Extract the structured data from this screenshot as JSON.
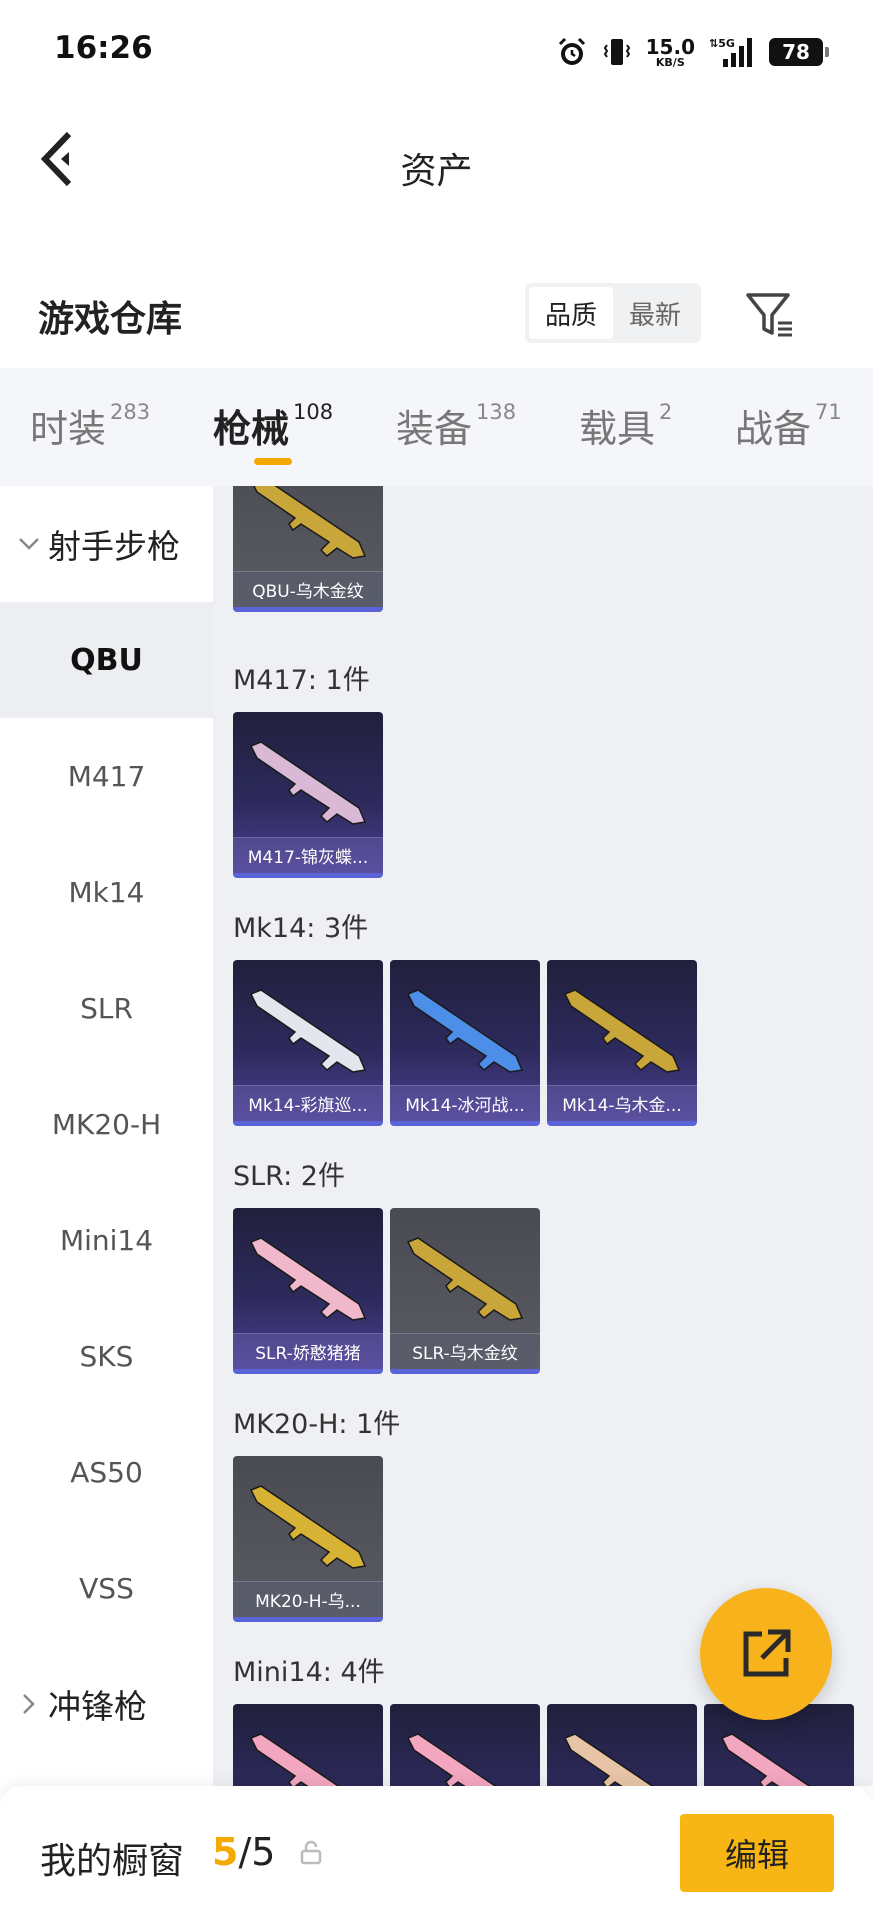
{
  "status": {
    "time": "16:26",
    "speed_value": "15.0",
    "speed_unit": "KB/S",
    "network": "5G",
    "battery": "78"
  },
  "header": {
    "title": "资产"
  },
  "section": {
    "title": "游戏仓库",
    "sort_options": [
      "品质",
      "最新"
    ],
    "active_sort": "品质"
  },
  "tabs": [
    {
      "label": "时装",
      "count": "283"
    },
    {
      "label": "枪械",
      "count": "108"
    },
    {
      "label": "装备",
      "count": "138"
    },
    {
      "label": "载具",
      "count": "2"
    },
    {
      "label": "战备",
      "count": "71"
    }
  ],
  "active_tab": "枪械",
  "sidebar": {
    "group_open": "射手步枪",
    "items": [
      "QBU",
      "M417",
      "Mk14",
      "SLR",
      "MK20-H",
      "Mini14",
      "SKS",
      "AS50",
      "VSS"
    ],
    "active_item": "QBU",
    "group_closed": "冲锋枪"
  },
  "content": {
    "groups": [
      {
        "title": "",
        "cards": [
          {
            "name": "QBU-乌木金纹",
            "style": "gray",
            "gun_color": "#d4ad3b"
          }
        ]
      },
      {
        "title": "M417: 1件",
        "cards": [
          {
            "name": "M417-锦灰蝶...",
            "style": "purple",
            "gun_color": "#d9b9d6"
          }
        ]
      },
      {
        "title": "Mk14: 3件",
        "cards": [
          {
            "name": "Mk14-彩旗巡...",
            "style": "purple",
            "gun_color": "#e3e6ef"
          },
          {
            "name": "Mk14-冰河战...",
            "style": "purple",
            "gun_color": "#4d8ee8"
          },
          {
            "name": "Mk14-乌木金...",
            "style": "purple",
            "gun_color": "#c9a63a"
          }
        ]
      },
      {
        "title": "SLR: 2件",
        "cards": [
          {
            "name": "SLR-娇憨猪猪",
            "style": "purple",
            "gun_color": "#f1b8cb"
          },
          {
            "name": "SLR-乌木金纹",
            "style": "gray",
            "gun_color": "#c9a63a"
          }
        ]
      },
      {
        "title": "MK20-H: 1件",
        "cards": [
          {
            "name": "MK20-H-乌...",
            "style": "gray",
            "gun_color": "#d8b234"
          }
        ]
      },
      {
        "title": "Mini14: 4件",
        "cards": [
          {
            "name": "",
            "style": "purple",
            "gun_color": "#f2a6c0"
          },
          {
            "name": "",
            "style": "purple",
            "gun_color": "#f2a6c0"
          },
          {
            "name": "",
            "style": "purple",
            "gun_color": "#e7c4a6"
          },
          {
            "name": "",
            "style": "purple",
            "gun_color": "#f2a6c0"
          }
        ]
      }
    ]
  },
  "bottom": {
    "label": "我的橱窗",
    "current": "5",
    "total": "/5",
    "edit_label": "编辑"
  },
  "colors": {
    "accent": "#f5a800",
    "card_border": "#5b63d8",
    "fab": "#f7b21c"
  }
}
